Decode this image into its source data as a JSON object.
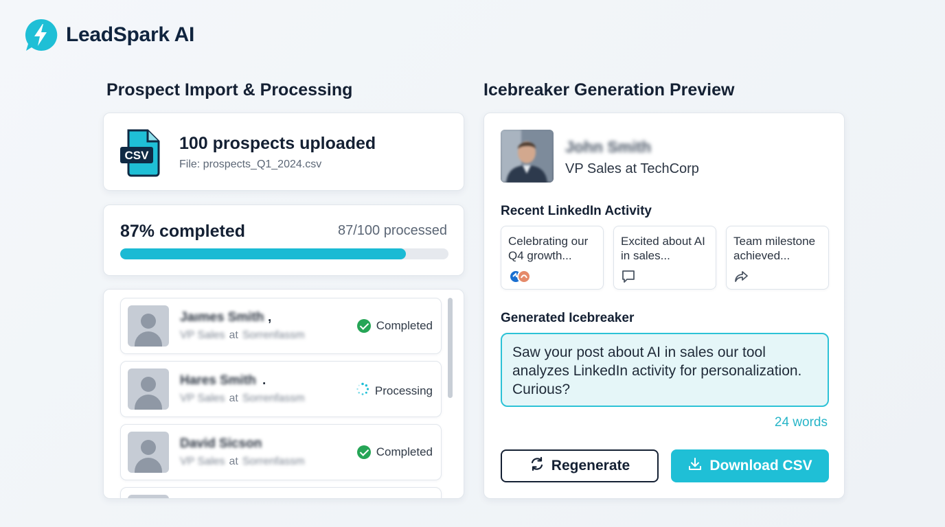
{
  "brand": {
    "name": "LeadSpark AI",
    "logo_icon": "lightning-chat-icon",
    "accent": "#1fbfd6"
  },
  "left_section": {
    "title": "Prospect Import & Processing",
    "upload": {
      "title": "100 prospects uploaded",
      "file": "File: prospects_Q1_2024.csv",
      "icon_label": "CSV"
    },
    "progress": {
      "label": "87% completed",
      "count": "87/100 processed",
      "value": 0.87
    },
    "prospects": [
      {
        "name": "Jaımes Smith",
        "comma": ",",
        "title": "VP Sales",
        "at": "at",
        "company": "Sorrenfassm",
        "status": "Completed",
        "status_icon": "check-circle-icon"
      },
      {
        "name": "Hares Smith",
        "comma": ".",
        "title": "VP Sales",
        "at": "at",
        "company": "Sorrenfassm",
        "status": "Processing",
        "status_icon": "spinner-icon"
      },
      {
        "name": "David Sicson",
        "comma": "",
        "title": "VP Sales",
        "at": "at",
        "company": "Sorrenfassm",
        "status": "Completed",
        "status_icon": "check-circle-icon"
      }
    ]
  },
  "right_section": {
    "title": "Icebreaker Generation Preview",
    "profile": {
      "name": "John Smith",
      "title": "VP Sales at TechCorp"
    },
    "activity_heading": "Recent LinkedIn Activity",
    "activities": [
      {
        "text": "Celebrating our Q4 growth...",
        "icon": "reactions-icon"
      },
      {
        "text": "Excited about AI in sales...",
        "icon": "comment-icon"
      },
      {
        "text": "Team milestone achieved...",
        "icon": "share-icon"
      }
    ],
    "generated_heading": "Generated Icebreaker",
    "icebreaker": "Saw your post about AI in sales our tool analyzes LinkedIn activity for personalization. Curious?",
    "word_count": "24 words",
    "buttons": {
      "regenerate": "Regenerate",
      "download": "Download CSV"
    }
  }
}
